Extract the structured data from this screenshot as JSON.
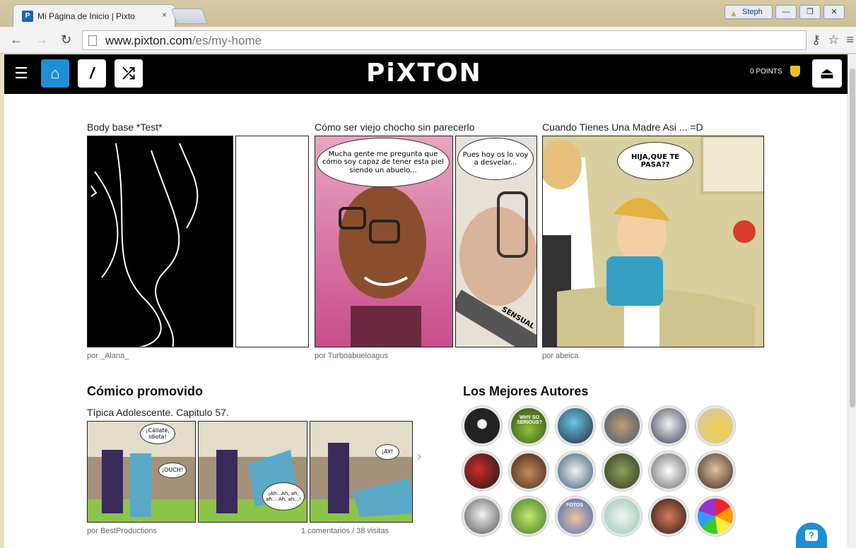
{
  "browser": {
    "tab_title": "Mi Página de Inicio | Pixto",
    "tab_close": "×",
    "favicon_letter": "P",
    "user_name": "Steph",
    "url_host": "www.pixton.com",
    "url_path": "/es/my-home",
    "win_minimize": "—",
    "win_restore": "❐",
    "win_close": "✕"
  },
  "header": {
    "logo": "PiXTON",
    "points": "0 POINTS",
    "menu_glyph": "☰",
    "home_glyph": "⌂",
    "pencil_glyph": "/",
    "shuffle_glyph": "⤮",
    "eject_glyph": "⏏"
  },
  "featured": [
    {
      "title": "Body base *Test*",
      "author": "por _Alana_"
    },
    {
      "title": "Cómo ser viejo chocho sin parecerlo",
      "author": "por Turboabueloagus",
      "bubble1": "Mucha gente me pregunta que cómo soy capaz de tener esta piel siendo un abuelo...",
      "bubble2": "Pues hoy os lo voy a desvelar...",
      "caption": "SENSUAL"
    },
    {
      "title": "Cuando Tienes Una Madre Asi ... =D",
      "author": "por abeica",
      "bubble1": "HIJA,QUE TE PASA??"
    }
  ],
  "promoted": {
    "heading": "Cómico promovido",
    "title": "Típica Adolescente. Capitulo 57.",
    "author": "por BestProductions",
    "stats": "1 comentarios / 38 visitas",
    "bubble1": "¡Cállate, idiota!",
    "bubble2": "¡OUCH!",
    "bubble3": "¡Ah...Ah, ah, ah... Ah, ah...!",
    "bubble4": "¡AY!",
    "next": "›"
  },
  "authors": {
    "heading": "Los Mejores Autores",
    "avatar_text_2": "WHY SO SERIOUS?",
    "avatar_text_19": "FOTOS"
  },
  "help": {
    "glyph": "?"
  },
  "colors": {
    "accent": "#1e8fd6",
    "header_bg": "#000000",
    "chrome_bg": "#cdbf97"
  }
}
